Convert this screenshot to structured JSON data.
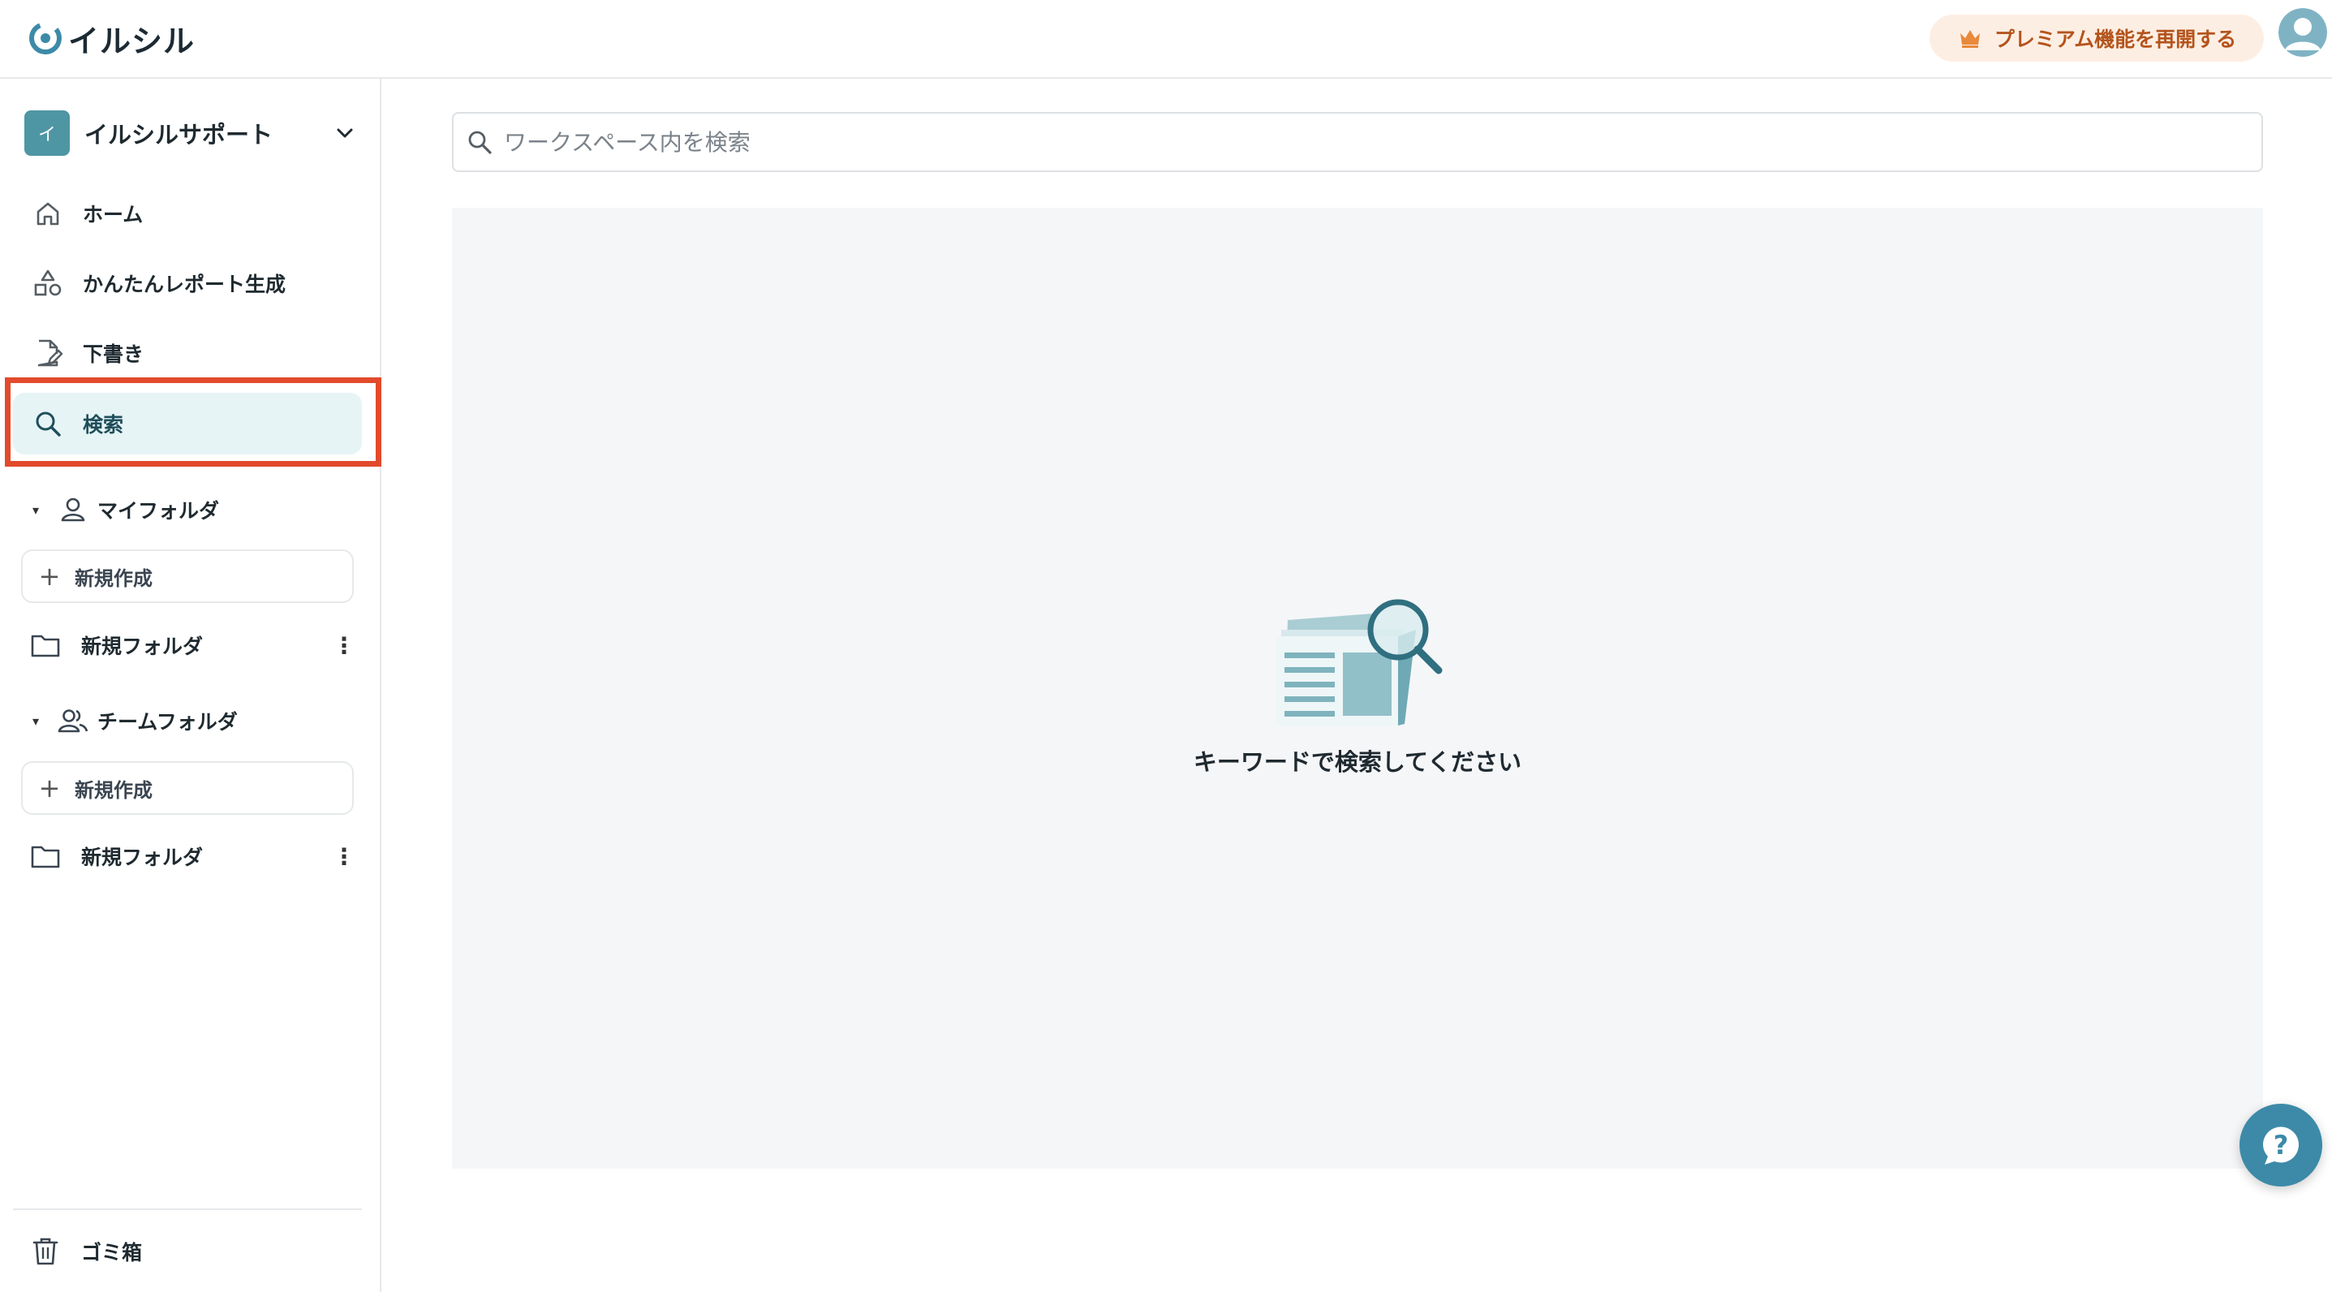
{
  "app": {
    "name": "イルシル"
  },
  "header": {
    "premium_label": "プレミアム機能を再開する"
  },
  "workspace": {
    "badge": "イ",
    "name": "イルシルサポート"
  },
  "nav": {
    "home": "ホーム",
    "report": "かんたんレポート生成",
    "drafts": "下書き",
    "search": "検索"
  },
  "my_folder": {
    "title": "マイフォルダ",
    "new_label": "新規作成",
    "items": [
      "新規フォルダ"
    ]
  },
  "team_folder": {
    "title": "チームフォルダ",
    "new_label": "新規作成",
    "items": [
      "新規フォルダ"
    ]
  },
  "trash": {
    "label": "ゴミ箱"
  },
  "search": {
    "placeholder": "ワークスペース内を検索",
    "empty_message": "キーワードで検索してください"
  },
  "colors": {
    "accent": "#4e96a4",
    "highlight": "#e24a2c",
    "premium_text": "#b4541c",
    "premium_bg": "#fdeee3"
  }
}
